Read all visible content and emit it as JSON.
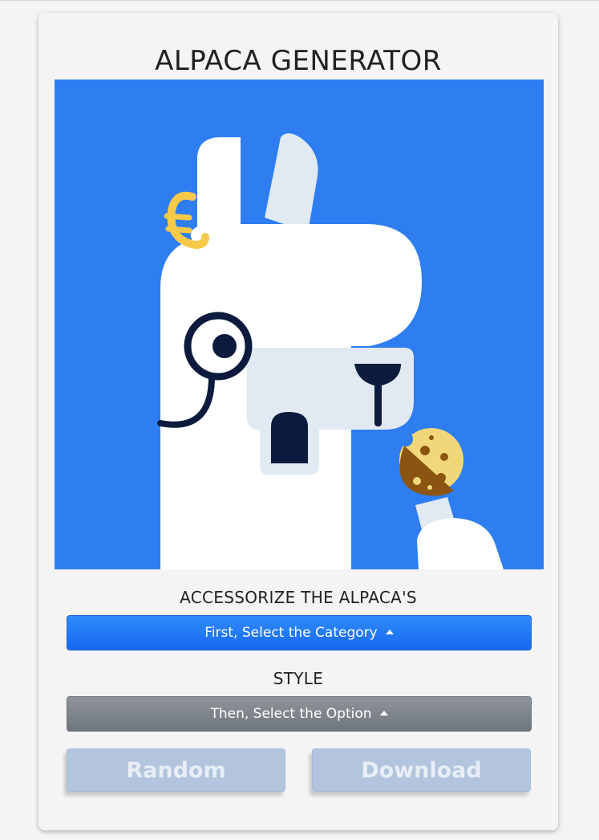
{
  "app": {
    "title": "ALPACA GENERATOR"
  },
  "preview": {
    "background_color": "#2e7ef2",
    "accessories": [
      "euro-earring-icon",
      "monocle-icon",
      "cookie-icon"
    ]
  },
  "controls": {
    "accessorize_label": "ACCESSORIZE THE ALPACA'S",
    "category_dropdown_label": "First, Select the Category",
    "style_label": "STYLE",
    "option_dropdown_label": "Then, Select the Option"
  },
  "actions": {
    "random_label": "Random",
    "download_label": "Download"
  },
  "colors": {
    "primary": "#1669f0",
    "secondary": "#6e757c",
    "disabled_button": "#b3c4df"
  }
}
